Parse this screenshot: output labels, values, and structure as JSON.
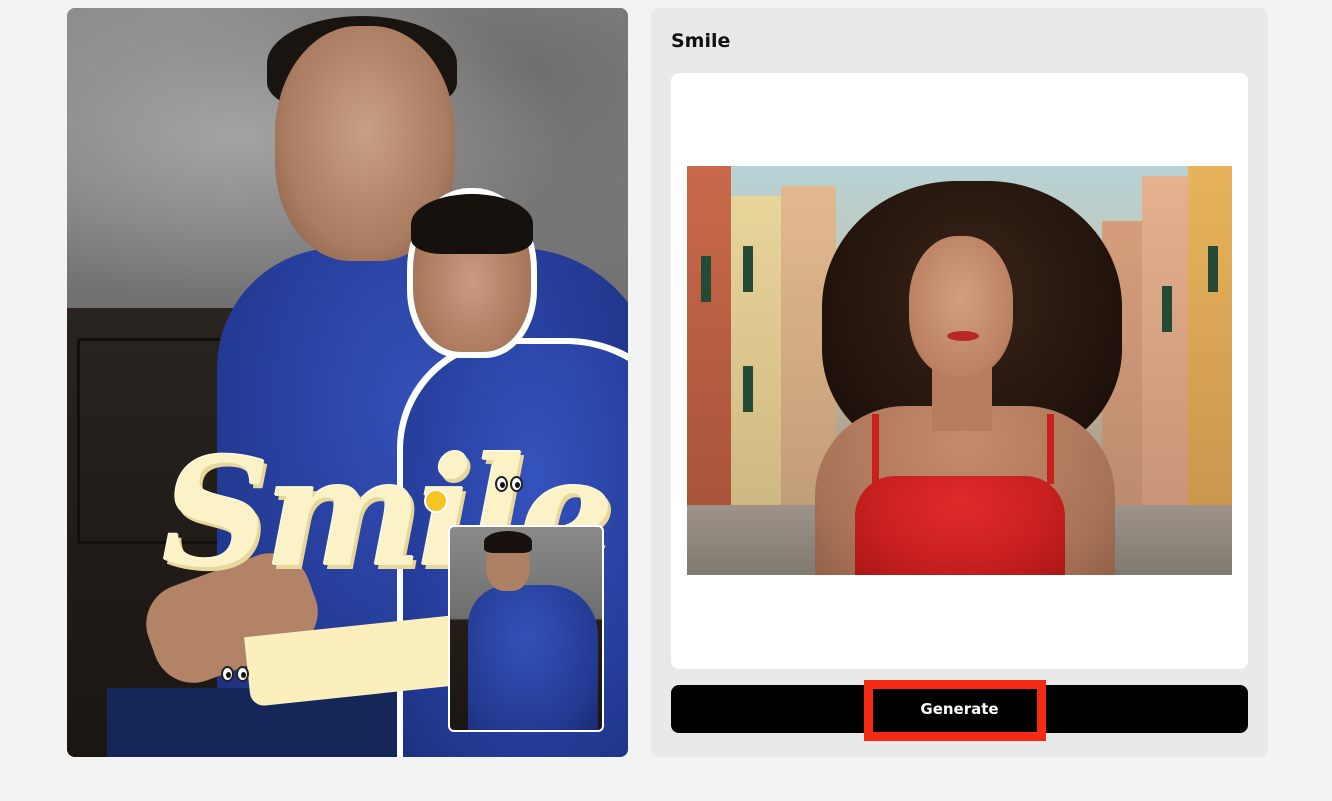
{
  "preview": {
    "overlay_text": "Smile",
    "image_alt": "Before and after example of a man in a blue shirt with Smile sticker text"
  },
  "panel": {
    "title": "Smile",
    "image_alt": "Woman with curly brown hair in red top on a colorful street"
  },
  "actions": {
    "generate_label": "Generate"
  },
  "colors": {
    "highlight": "#f52a14",
    "button_bg": "#000000",
    "panel_bg": "#e9e9e9"
  }
}
